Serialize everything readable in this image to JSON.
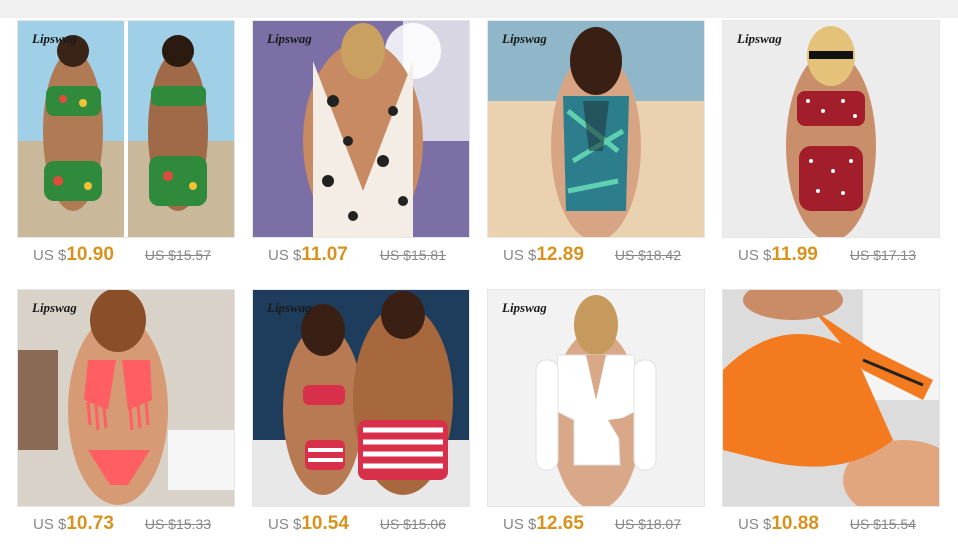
{
  "products": [
    {
      "brand": "Lipswag",
      "currency": "US $",
      "price": "10.90",
      "old_price": "US $15.57",
      "image": "floral-bikini-front-back",
      "accent": "#2f8a3c"
    },
    {
      "brand": "Lipswag",
      "currency": "US $",
      "price": "11.07",
      "old_price": "US $15.81",
      "image": "leopard-plunge-swimsuit",
      "accent": "#f3ede6"
    },
    {
      "brand": "Lipswag",
      "currency": "US $",
      "price": "12.89",
      "old_price": "US $18.42",
      "image": "tropical-mesh-swimsuit",
      "accent": "#2d7e8c"
    },
    {
      "brand": "Lipswag",
      "currency": "US $",
      "price": "11.99",
      "old_price": "US $17.13",
      "image": "polka-dot-bandeau-swimsuit",
      "accent": "#a11e2a"
    },
    {
      "brand": "Lipswag",
      "currency": "US $",
      "price": "10.73",
      "old_price": "US $15.33",
      "image": "coral-fringe-bikini",
      "accent": "#ff5f63"
    },
    {
      "brand": "Lipswag",
      "currency": "US $",
      "price": "10.54",
      "old_price": "US $15.06",
      "image": "couple-striped-swimwear",
      "accent": "#d8304a"
    },
    {
      "brand": "Lipswag",
      "currency": "US $",
      "price": "12.65",
      "old_price": "US $18.07",
      "image": "white-longsleeve-swimsuit",
      "accent": "#ffffff"
    },
    {
      "brand": "",
      "currency": "US $",
      "price": "10.88",
      "old_price": "US $15.54",
      "image": "orange-one-shoulder-swimsuit",
      "accent": "#f47a1f"
    }
  ]
}
